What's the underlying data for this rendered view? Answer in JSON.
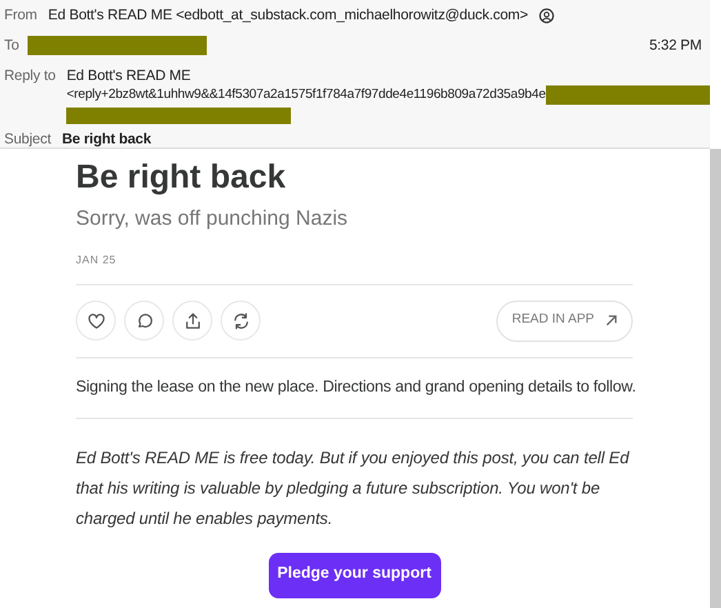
{
  "header": {
    "from_label": "From",
    "from": "Ed Bott's READ ME <edbott_at_substack.com_michaelhorowitz@duck.com>",
    "to_label": "To",
    "time": "5:32 PM",
    "reply_to_label": "Reply to",
    "reply_to_name": "Ed Bott's READ ME",
    "reply_to_address": "<reply+2bz8wt&1uhhw9&&14f5307a2a1575f1f784a7f97dde4e1196b809a72d35a9b4e",
    "subject_label": "Subject",
    "subject": "Be right back"
  },
  "post": {
    "title": "Be right back",
    "subtitle": "Sorry, was off punching Nazis",
    "date": "JAN 25",
    "actions": [
      {
        "kind": "like"
      },
      {
        "kind": "comment"
      },
      {
        "kind": "share"
      },
      {
        "kind": "restack"
      }
    ],
    "read_in_app": "READ IN APP",
    "body": "Signing the lease on the new place. Directions and grand opening details to follow.",
    "footer": "Ed Bott's READ ME is free today. But if you enjoyed this post, you can tell Ed that his writing is valuable by pledging a future subscription. You won't be charged until he enables payments.",
    "pledge_button": "Pledge your support"
  }
}
